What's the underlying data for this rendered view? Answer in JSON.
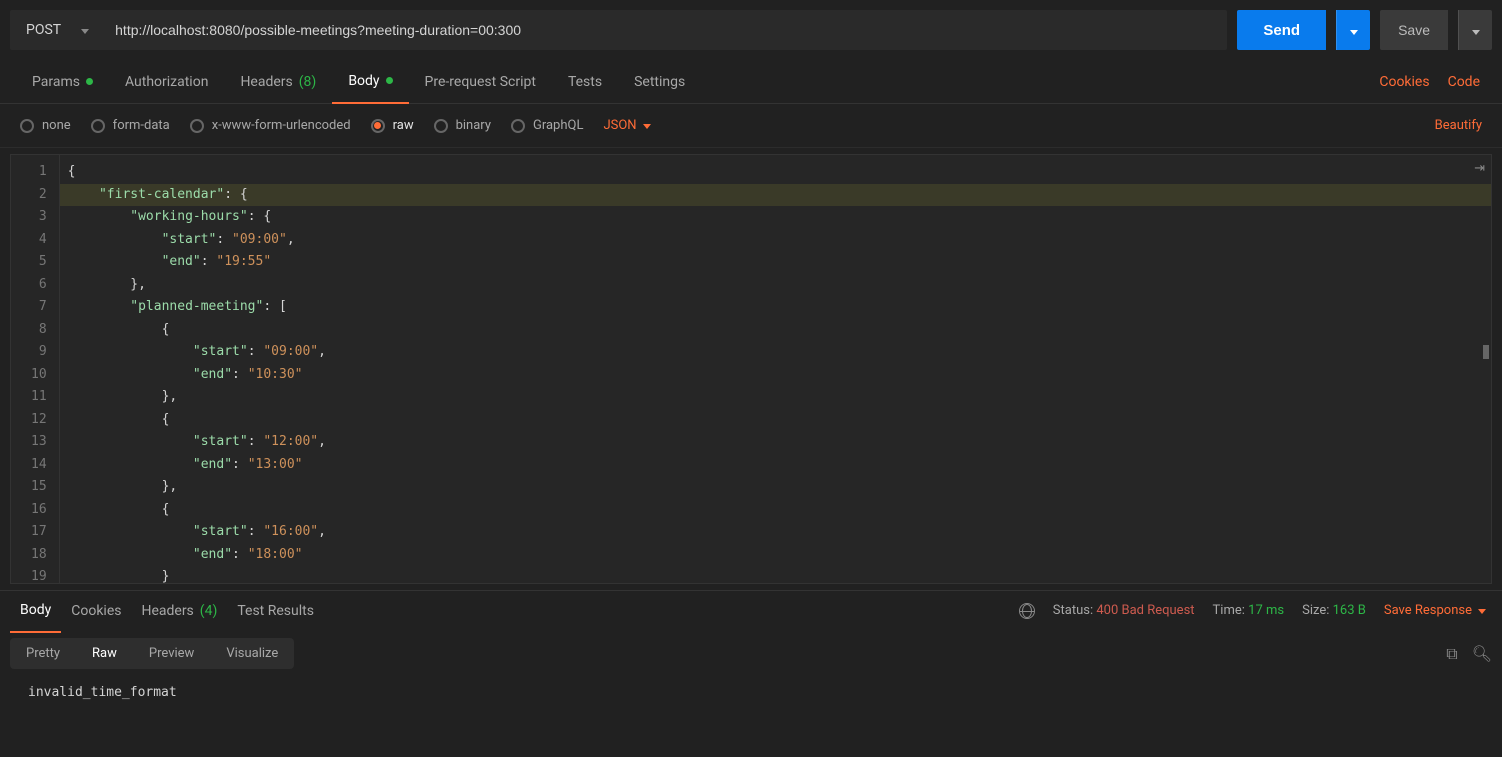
{
  "request": {
    "method": "POST",
    "url": "http://localhost:8080/possible-meetings?meeting-duration=00:300",
    "send_label": "Send",
    "save_label": "Save"
  },
  "tabs": {
    "params": "Params",
    "authorization": "Authorization",
    "headers": "Headers",
    "headers_count": "(8)",
    "body": "Body",
    "prerequest": "Pre-request Script",
    "tests": "Tests",
    "settings": "Settings",
    "cookies": "Cookies",
    "code": "Code"
  },
  "body_types": {
    "none": "none",
    "formdata": "form-data",
    "xwww": "x-www-form-urlencoded",
    "raw": "raw",
    "binary": "binary",
    "graphql": "GraphQL",
    "json": "JSON",
    "beautify": "Beautify"
  },
  "editor": {
    "lines": [
      {
        "indent": 0,
        "tokens": [
          {
            "t": "p",
            "v": "{"
          }
        ]
      },
      {
        "indent": 1,
        "hl": true,
        "tokens": [
          {
            "t": "k",
            "v": "\"first-calendar\""
          },
          {
            "t": "p",
            "v": ": {"
          }
        ]
      },
      {
        "indent": 2,
        "tokens": [
          {
            "t": "k",
            "v": "\"working-hours\""
          },
          {
            "t": "p",
            "v": ": {"
          }
        ]
      },
      {
        "indent": 3,
        "tokens": [
          {
            "t": "k",
            "v": "\"start\""
          },
          {
            "t": "p",
            "v": ": "
          },
          {
            "t": "s",
            "v": "\"09:00\""
          },
          {
            "t": "p",
            "v": ","
          }
        ]
      },
      {
        "indent": 3,
        "tokens": [
          {
            "t": "k",
            "v": "\"end\""
          },
          {
            "t": "p",
            "v": ": "
          },
          {
            "t": "s",
            "v": "\"19:55\""
          }
        ]
      },
      {
        "indent": 2,
        "tokens": [
          {
            "t": "p",
            "v": "},"
          }
        ]
      },
      {
        "indent": 2,
        "tokens": [
          {
            "t": "k",
            "v": "\"planned-meeting\""
          },
          {
            "t": "p",
            "v": ": ["
          }
        ]
      },
      {
        "indent": 3,
        "tokens": [
          {
            "t": "p",
            "v": "{"
          }
        ]
      },
      {
        "indent": 4,
        "tokens": [
          {
            "t": "k",
            "v": "\"start\""
          },
          {
            "t": "p",
            "v": ": "
          },
          {
            "t": "s",
            "v": "\"09:00\""
          },
          {
            "t": "p",
            "v": ","
          }
        ]
      },
      {
        "indent": 4,
        "tokens": [
          {
            "t": "k",
            "v": "\"end\""
          },
          {
            "t": "p",
            "v": ": "
          },
          {
            "t": "s",
            "v": "\"10:30\""
          }
        ]
      },
      {
        "indent": 3,
        "tokens": [
          {
            "t": "p",
            "v": "},"
          }
        ]
      },
      {
        "indent": 3,
        "tokens": [
          {
            "t": "p",
            "v": "{"
          }
        ]
      },
      {
        "indent": 4,
        "tokens": [
          {
            "t": "k",
            "v": "\"start\""
          },
          {
            "t": "p",
            "v": ": "
          },
          {
            "t": "s",
            "v": "\"12:00\""
          },
          {
            "t": "p",
            "v": ","
          }
        ]
      },
      {
        "indent": 4,
        "tokens": [
          {
            "t": "k",
            "v": "\"end\""
          },
          {
            "t": "p",
            "v": ": "
          },
          {
            "t": "s",
            "v": "\"13:00\""
          }
        ]
      },
      {
        "indent": 3,
        "tokens": [
          {
            "t": "p",
            "v": "},"
          }
        ]
      },
      {
        "indent": 3,
        "tokens": [
          {
            "t": "p",
            "v": "{"
          }
        ]
      },
      {
        "indent": 4,
        "tokens": [
          {
            "t": "k",
            "v": "\"start\""
          },
          {
            "t": "p",
            "v": ": "
          },
          {
            "t": "s",
            "v": "\"16:00\""
          },
          {
            "t": "p",
            "v": ","
          }
        ]
      },
      {
        "indent": 4,
        "tokens": [
          {
            "t": "k",
            "v": "\"end\""
          },
          {
            "t": "p",
            "v": ": "
          },
          {
            "t": "s",
            "v": "\"18:00\""
          }
        ]
      },
      {
        "indent": 3,
        "tokens": [
          {
            "t": "p",
            "v": "}"
          }
        ]
      }
    ]
  },
  "response": {
    "tabs": {
      "body": "Body",
      "cookies": "Cookies",
      "headers": "Headers",
      "headers_count": "(4)",
      "test_results": "Test Results"
    },
    "status_label": "Status:",
    "status_value": "400 Bad Request",
    "time_label": "Time:",
    "time_value": "17 ms",
    "size_label": "Size:",
    "size_value": "163 B",
    "save_response": "Save Response",
    "views": {
      "pretty": "Pretty",
      "raw": "Raw",
      "preview": "Preview",
      "visualize": "Visualize"
    },
    "body_text": "invalid_time_format"
  }
}
